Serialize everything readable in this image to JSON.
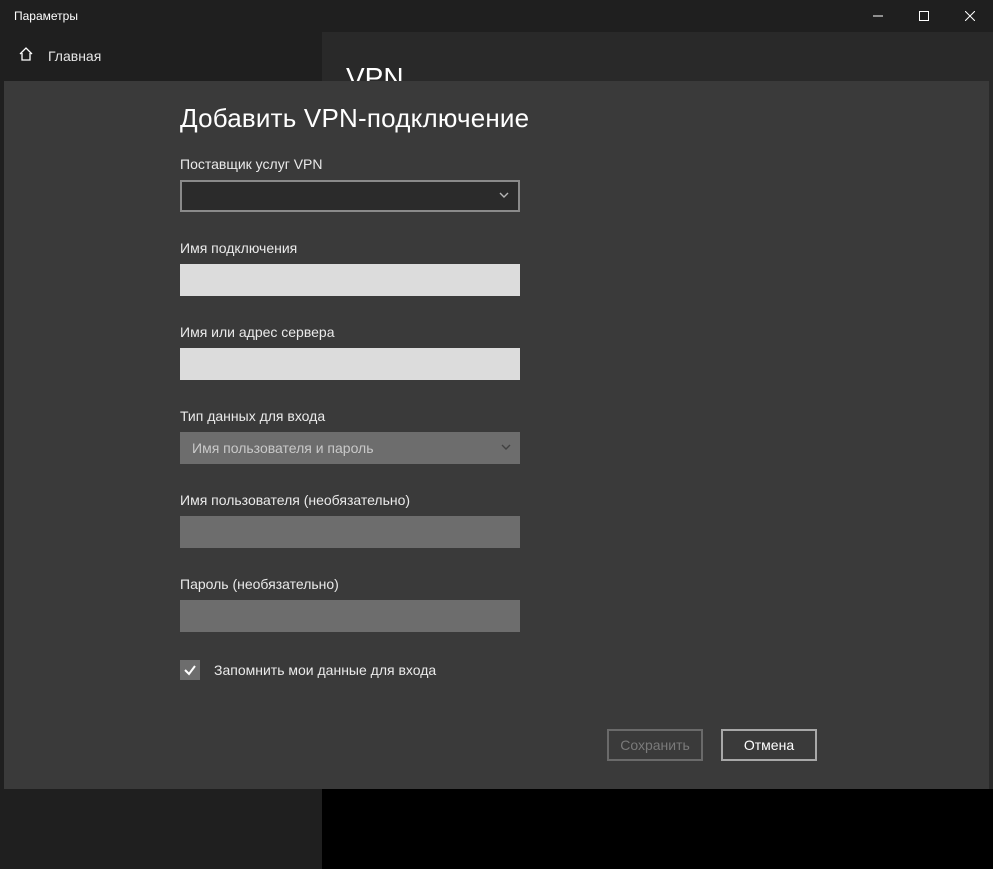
{
  "window": {
    "title": "Параметры",
    "home_label": "Главная"
  },
  "page": {
    "title": "VPN"
  },
  "dialog": {
    "title": "Добавить VPN-подключение",
    "provider_label": "Поставщик услуг VPN",
    "provider_value": "",
    "connection_name_label": "Имя подключения",
    "connection_name_value": "",
    "server_label": "Имя или адрес сервера",
    "server_value": "",
    "signin_type_label": "Тип данных для входа",
    "signin_type_value": "Имя пользователя и пароль",
    "username_label": "Имя пользователя (необязательно)",
    "username_value": "",
    "password_label": "Пароль (необязательно)",
    "password_value": "",
    "remember_label": "Запомнить мои данные для входа",
    "remember_checked": true,
    "save_label": "Сохранить",
    "cancel_label": "Отмена"
  }
}
